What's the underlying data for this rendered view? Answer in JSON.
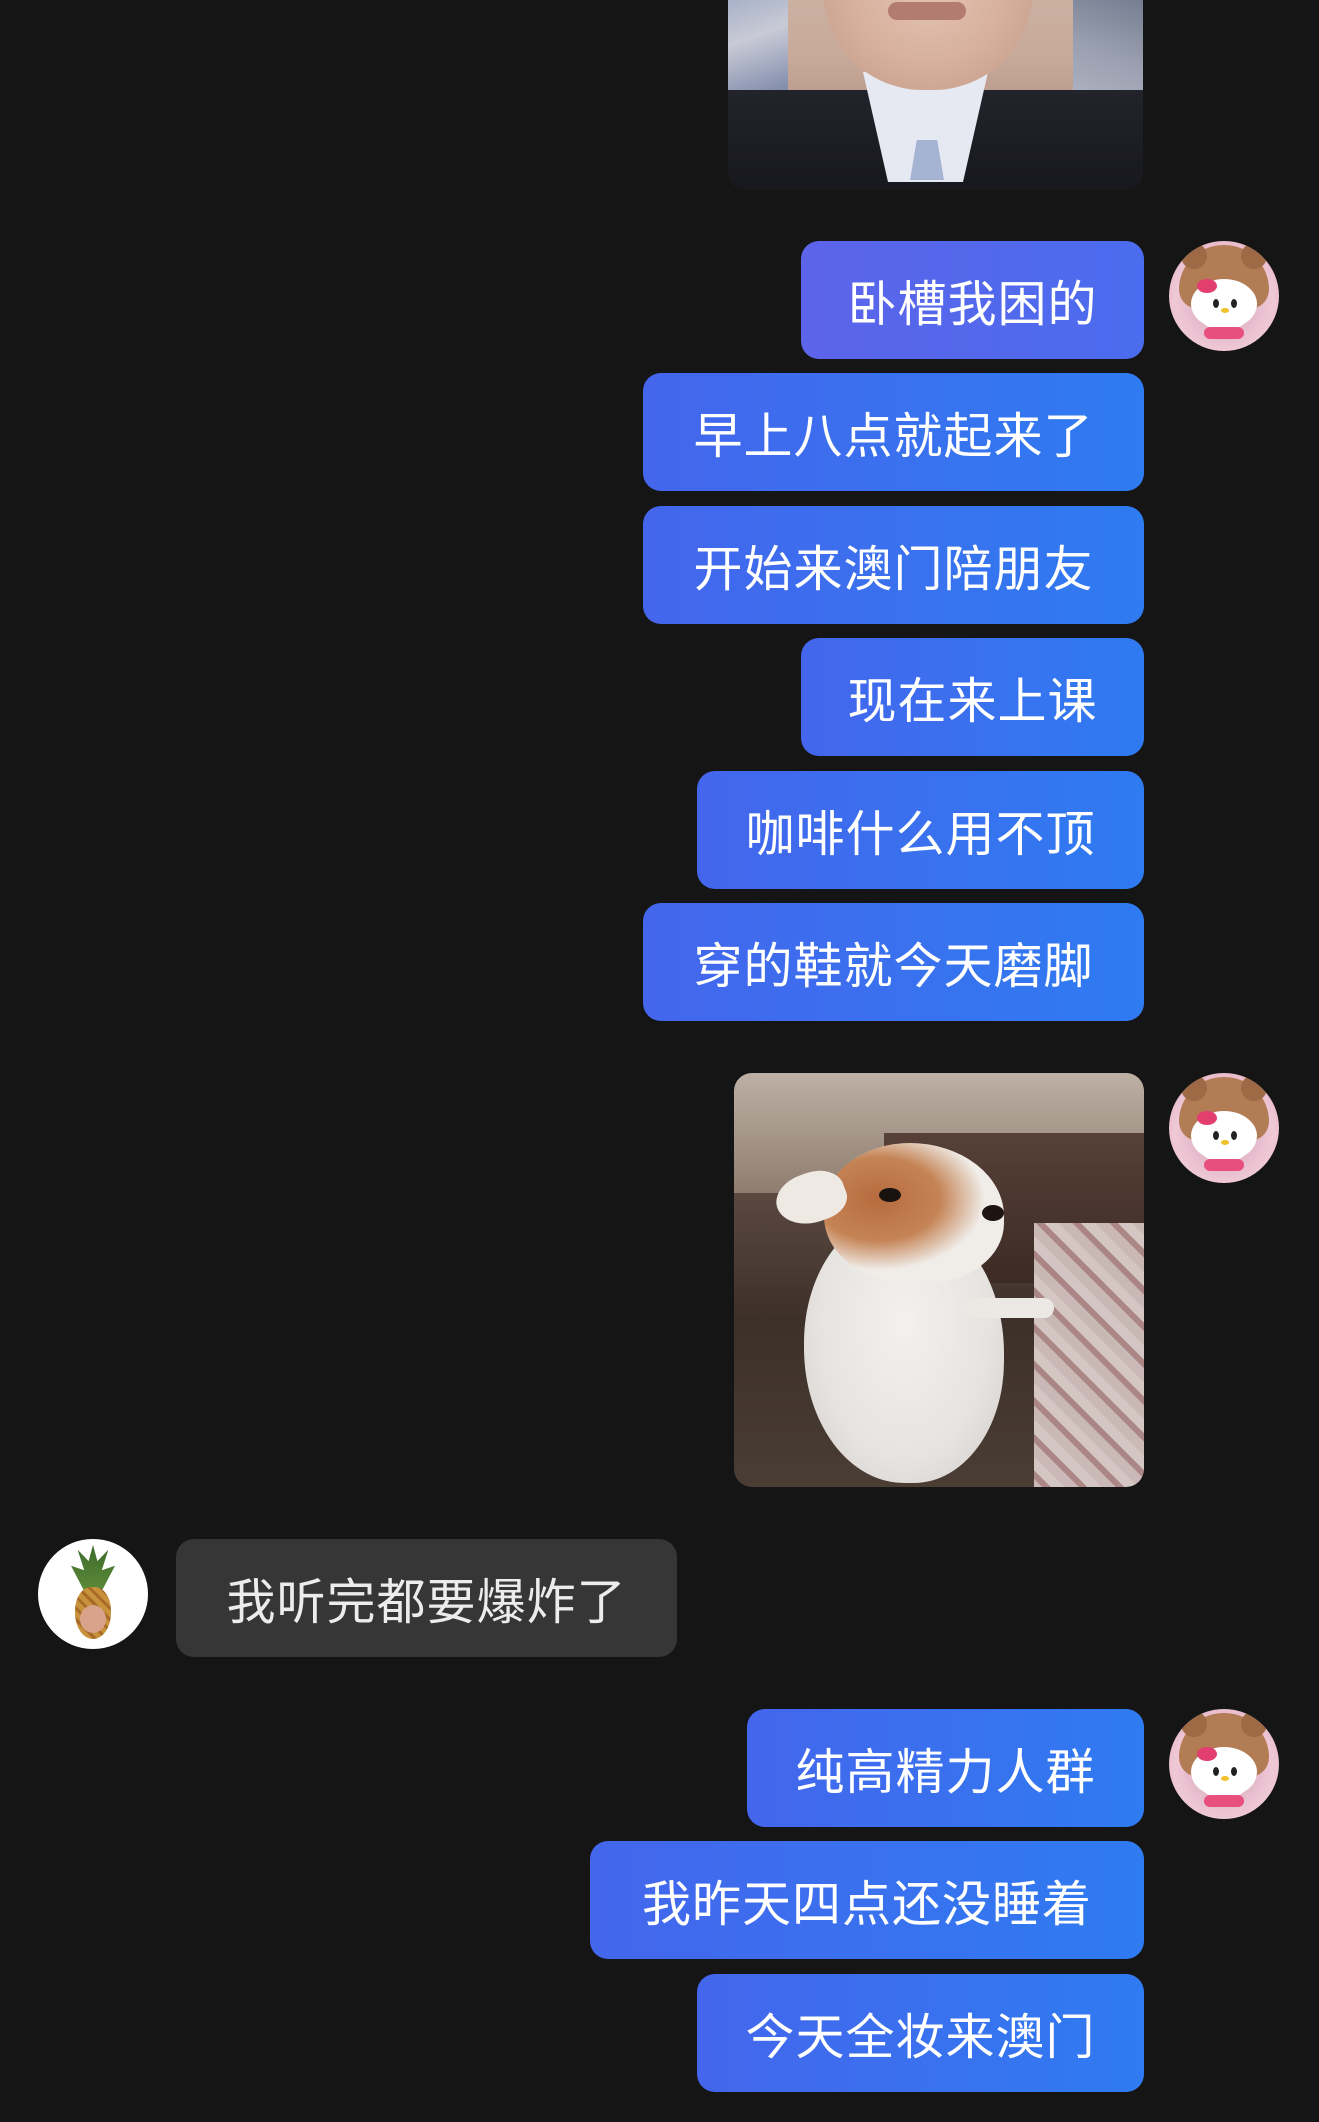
{
  "messages": {
    "m1": "卧槽我困的",
    "m2": "早上八点就起来了",
    "m3": "开始来澳门陪朋友",
    "m4": "现在来上课",
    "m5": "咖啡什么用不顶",
    "m6": "穿的鞋就今天磨脚",
    "m7": "我听完都要爆炸了",
    "m8": "纯高精力人群",
    "m9": "我昨天四点还没睡着",
    "m10": "今天全妆来澳门"
  }
}
